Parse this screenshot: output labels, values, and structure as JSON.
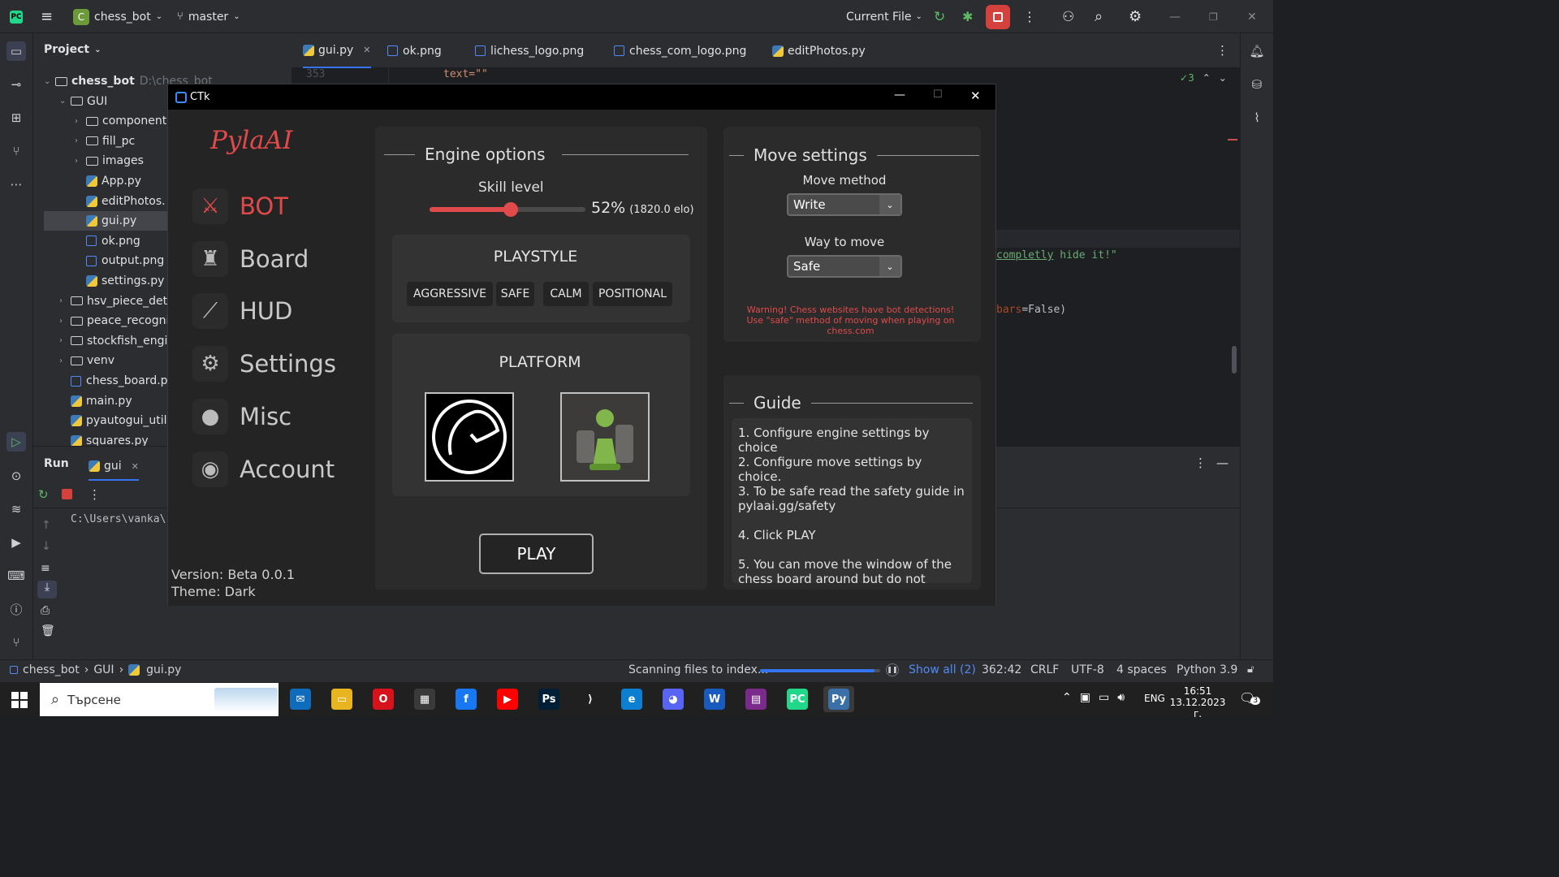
{
  "ide": {
    "project_name": "chess_bot",
    "project_badge": "C",
    "branch": "master",
    "run_config": "Current File",
    "project_label": "Project",
    "tree": [
      {
        "label": "chess_bot",
        "suffix": "D:\\chess_bot",
        "type": "folder",
        "indent": 0,
        "arrow": "⌄"
      },
      {
        "label": "GUI",
        "type": "folder",
        "indent": 1,
        "arrow": "⌄"
      },
      {
        "label": "component",
        "type": "folder",
        "indent": 2,
        "arrow": "›"
      },
      {
        "label": "fill_pc",
        "type": "folder",
        "indent": 2,
        "arrow": "›"
      },
      {
        "label": "images",
        "type": "folder",
        "indent": 2,
        "arrow": "›"
      },
      {
        "label": "App.py",
        "type": "py",
        "indent": 2
      },
      {
        "label": "editPhotos.",
        "type": "py",
        "indent": 2
      },
      {
        "label": "gui.py",
        "type": "py",
        "indent": 2,
        "selected": true
      },
      {
        "label": "ok.png",
        "type": "png",
        "indent": 2
      },
      {
        "label": "output.png",
        "type": "png",
        "indent": 2
      },
      {
        "label": "settings.py",
        "type": "py",
        "indent": 2
      },
      {
        "label": "hsv_piece_dete",
        "type": "folder",
        "indent": 1,
        "arrow": "›"
      },
      {
        "label": "peace_recogni",
        "type": "folder",
        "indent": 1,
        "arrow": "›"
      },
      {
        "label": "stockfish_engi",
        "type": "folder",
        "indent": 1,
        "arrow": "›"
      },
      {
        "label": "venv",
        "type": "folder",
        "indent": 1,
        "arrow": "›"
      },
      {
        "label": "chess_board.p",
        "type": "png",
        "indent": 1
      },
      {
        "label": "main.py",
        "type": "py",
        "indent": 1
      },
      {
        "label": "pyautogui_utils",
        "type": "py",
        "indent": 1
      },
      {
        "label": "squares.py",
        "type": "py",
        "indent": 1
      }
    ],
    "tabs": [
      {
        "label": "gui.py",
        "type": "py",
        "active": true
      },
      {
        "label": "ok.png",
        "type": "png"
      },
      {
        "label": "lichess_logo.png",
        "type": "png"
      },
      {
        "label": "chess_com_logo.png",
        "type": "png"
      },
      {
        "label": "editPhotos.py",
        "type": "py"
      }
    ],
    "code": {
      "line_no": "353",
      "line_text": "text=\"\"",
      "snippet1_underlined": "completly",
      "snippet1_rest": " hide it!\"",
      "snippet2_param": "bars",
      "snippet2_rest": "=False)",
      "inspection_count": "3"
    },
    "run": {
      "label": "Run",
      "tab": "gui",
      "console": "C:\\Users\\vanka\\"
    },
    "status": {
      "breadcrumb": [
        "chess_bot",
        "GUI",
        "gui.py"
      ],
      "scanning": "Scanning files to index...",
      "show_all": "Show all (2)",
      "position": "362:42",
      "line_sep": "CRLF",
      "encoding": "UTF-8",
      "indent": "4 spaces",
      "interpreter": "Python 3.9",
      "progress": 0.95
    }
  },
  "app": {
    "window_title": "CTk",
    "logo": "PylaAI",
    "nav": [
      {
        "label": "BOT",
        "icon": "swords-icon",
        "glyph": "⚔",
        "active": true
      },
      {
        "label": "Board",
        "icon": "chess-pieces-icon",
        "glyph": "♜"
      },
      {
        "label": "HUD",
        "icon": "brush-icon",
        "glyph": "⟋"
      },
      {
        "label": "Settings",
        "icon": "gears-icon",
        "glyph": "⚙"
      },
      {
        "label": "Misc",
        "icon": "lightbulb-icon",
        "glyph": "●"
      },
      {
        "label": "Account",
        "icon": "user-icon",
        "glyph": "◉"
      }
    ],
    "version": "Version: Beta 0.0.1",
    "theme": "Theme: Dark",
    "engine": {
      "title": "Engine options",
      "skill_label": "Skill level",
      "skill_percent": "52%",
      "skill_value": 0.52,
      "elo": "(1820.0 elo)"
    },
    "playstyle": {
      "title": "PLAYSTYLE",
      "options": [
        "AGGRESSIVE",
        "SAFE",
        "CALM",
        "POSITIONAL"
      ]
    },
    "platform": {
      "title": "PLATFORM",
      "options": [
        "lichess-logo",
        "chess-com-logo"
      ]
    },
    "play_label": "PLAY",
    "move": {
      "title": "Move settings",
      "method_label": "Move method",
      "method_value": "Write",
      "way_label": "Way to move",
      "way_value": "Safe",
      "warning1": "Warning! Chess websites have bot detections!",
      "warning2": "Use \"safe\" method of moving when playing on chess.com"
    },
    "guide": {
      "title": "Guide",
      "items": [
        "1. Configure engine settings by choice",
        "2. Configure move settings by choice.",
        "3. To be safe read the safety guide in pylaai.gg/safety",
        "4. Click PLAY",
        "5. You can move the window of the chess board around but do not"
      ]
    }
  },
  "taskbar": {
    "search_placeholder": "Търсене",
    "lang": "ENG",
    "time": "16:51",
    "date": "13.12.2023 г.",
    "apps": [
      {
        "name": "mail-icon",
        "bg": "#0f6cbd",
        "glyph": "✉"
      },
      {
        "name": "file-explorer-icon",
        "bg": "#e8b420",
        "glyph": "▭"
      },
      {
        "name": "opera-icon",
        "bg": "#d8121a",
        "glyph": "O"
      },
      {
        "name": "store-icon",
        "bg": "#3a3a3a",
        "glyph": "▦"
      },
      {
        "name": "facebook-icon",
        "bg": "#1877f2",
        "glyph": "f"
      },
      {
        "name": "youtube-icon",
        "bg": "#ff0000",
        "glyph": "▶"
      },
      {
        "name": "photoshop-icon",
        "bg": "#001e36",
        "glyph": "Ps"
      },
      {
        "name": "vscode-icon",
        "bg": "#202020",
        "glyph": "⟩"
      },
      {
        "name": "edge-icon",
        "bg": "#0c7fd2",
        "glyph": "e"
      },
      {
        "name": "discord-icon",
        "bg": "#5865f2",
        "glyph": "◕"
      },
      {
        "name": "word-icon",
        "bg": "#185abd",
        "glyph": "W"
      },
      {
        "name": "winrar-icon",
        "bg": "#7a2a8a",
        "glyph": "▤"
      },
      {
        "name": "pycharm-icon",
        "bg": "#21d789",
        "glyph": "PC"
      },
      {
        "name": "python-icon",
        "bg": "#3b6fa8",
        "glyph": "Py"
      }
    ]
  }
}
